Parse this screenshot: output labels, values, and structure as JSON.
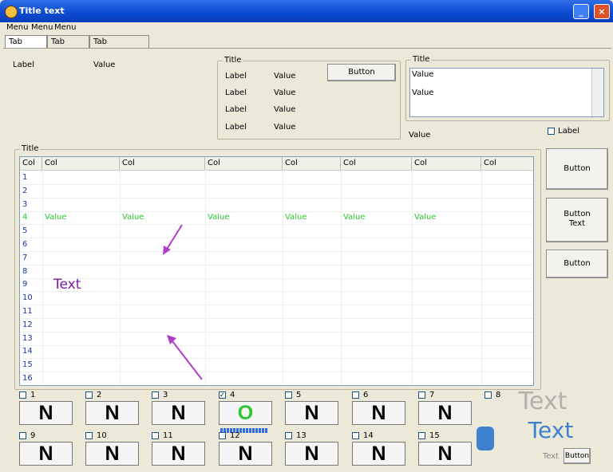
{
  "window": {
    "title": "Title text",
    "min_label": "",
    "max_label": "",
    "close_label": "×"
  },
  "menu": [
    "Menu",
    "Menu",
    "Menu"
  ],
  "tabs": [
    "Tab",
    "Tab",
    "Tab"
  ],
  "config": {
    "label": "Label",
    "value": "Value"
  },
  "counter": {
    "title": "Title",
    "rate_label": "Label",
    "rate_value": "Value",
    "tested_label": "Label",
    "tested_value": "Value",
    "success_label": "Label",
    "success_value": "Value",
    "fail_label": "Label",
    "fail_value": "Value",
    "reset_button": "Button"
  },
  "firmware": {
    "title": "Title",
    "flash_db": "Value",
    "fw_version": "Value"
  },
  "elapsed": "Value",
  "timing_mode": "Label",
  "devices": {
    "title": "Title",
    "columns": [
      "Col",
      "Col",
      "Col",
      "Col",
      "Col",
      "Col",
      "Col",
      "Col"
    ],
    "rows": [
      {
        "n": "1"
      },
      {
        "n": "2"
      },
      {
        "n": "3"
      },
      {
        "n": "4",
        "id": "Value",
        "status": "Value",
        "serial": "Value",
        "capacity": "Value",
        "bad": "Value",
        "vendor": "Value"
      },
      {
        "n": "5"
      },
      {
        "n": "6"
      },
      {
        "n": "7"
      },
      {
        "n": "8"
      },
      {
        "n": "9"
      },
      {
        "n": "10"
      },
      {
        "n": "11"
      },
      {
        "n": "12"
      },
      {
        "n": "13"
      },
      {
        "n": "14"
      },
      {
        "n": "15"
      },
      {
        "n": "16"
      }
    ]
  },
  "buttons": {
    "search": "Button",
    "start": "Button",
    "start_sub": "Text",
    "stop": "Button",
    "leave": "Button"
  },
  "annotation": "Text",
  "slots": [
    {
      "n": "1",
      "mark": "N",
      "checked": false
    },
    {
      "n": "2",
      "mark": "N",
      "checked": false
    },
    {
      "n": "3",
      "mark": "N",
      "checked": false
    },
    {
      "n": "4",
      "mark": "O",
      "checked": true,
      "progress": true
    },
    {
      "n": "5",
      "mark": "N",
      "checked": false
    },
    {
      "n": "6",
      "mark": "N",
      "checked": false
    },
    {
      "n": "7",
      "mark": "N",
      "checked": false
    },
    {
      "n": "8",
      "mark": "",
      "checked": false
    },
    {
      "n": "9",
      "mark": "N",
      "checked": false
    },
    {
      "n": "10",
      "mark": "N",
      "checked": false
    },
    {
      "n": "11",
      "mark": "N",
      "checked": false
    },
    {
      "n": "12",
      "mark": "N",
      "checked": false
    },
    {
      "n": "13",
      "mark": "N",
      "checked": false
    },
    {
      "n": "14",
      "mark": "N",
      "checked": false
    },
    {
      "n": "15",
      "mark": "N",
      "checked": false
    }
  ],
  "watermark": {
    "line1": "Text",
    "line2": "Text",
    "line3": "Text"
  },
  "colors": {
    "success": "#2ec62e",
    "annotation": "#7a1aa0",
    "titlebar": "#0a4ad0"
  }
}
